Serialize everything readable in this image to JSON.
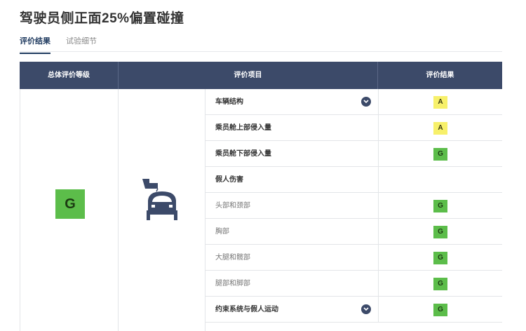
{
  "page_title": "驾驶员侧正面25%偏置碰撞",
  "tabs": [
    {
      "label": "评价结果",
      "active": true
    },
    {
      "label": "试验细节",
      "active": false
    }
  ],
  "table": {
    "headers": {
      "overall": "总体评价等级",
      "items": "评价项目",
      "result": "评价结果"
    },
    "overall_grade": "G",
    "rows": [
      {
        "label": "车辆结构",
        "grade": "A",
        "style": "bold",
        "expandable": true
      },
      {
        "label": "乘员舱上部侵入量",
        "grade": "A",
        "style": "bold",
        "expandable": false
      },
      {
        "label": "乘员舱下部侵入量",
        "grade": "G",
        "style": "bold",
        "expandable": false
      },
      {
        "label": "假人伤害",
        "grade": "",
        "style": "bold",
        "expandable": false
      },
      {
        "label": "头部和颈部",
        "grade": "G",
        "style": "sub",
        "expandable": false
      },
      {
        "label": "胸部",
        "grade": "G",
        "style": "sub",
        "expandable": false
      },
      {
        "label": "大腿和髋部",
        "grade": "G",
        "style": "sub",
        "expandable": false
      },
      {
        "label": "腿部和脚部",
        "grade": "G",
        "style": "sub",
        "expandable": false
      },
      {
        "label": "约束系统与假人运动",
        "grade": "G",
        "style": "bold",
        "expandable": true
      }
    ]
  },
  "colors": {
    "header_bg": "#3c4a69",
    "grade_good": "#5cbd4a",
    "grade_acceptable": "#f7f06a",
    "accent": "#1f3a5f"
  },
  "icons": {
    "offset_crash": "offset-crash-car-icon",
    "expand": "chevron-down-icon"
  }
}
